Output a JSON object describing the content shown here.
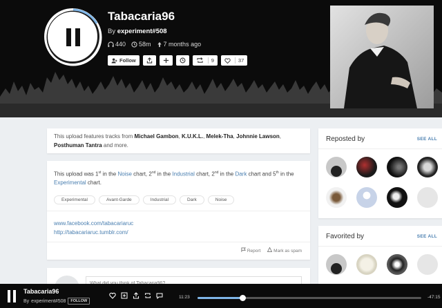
{
  "colors": {
    "accent": "#4a7fb0",
    "progress": "#7fb6e8",
    "dark": "#0b0b0b"
  },
  "track": {
    "title": "Tabacaria96",
    "by_prefix": "By",
    "author": "experiment#508",
    "plays": "440",
    "duration": "58m",
    "age": "7 months ago"
  },
  "actions": {
    "follow_label": "Follow",
    "repost_count": "9",
    "favorite_count": "37"
  },
  "description": {
    "intro": "This upload features tracks from",
    "artists": [
      "Michael Gambon",
      "K.U.K.L.",
      "Melek-Tha",
      "Johnnie Lawson",
      "Posthuman Tantra"
    ],
    "outro": "and more."
  },
  "ranking": {
    "prefix": "This upload was",
    "items": [
      {
        "pos": "1",
        "suffix": "st",
        "pre": "in the",
        "chart": "Noise",
        "post": "chart,"
      },
      {
        "pos": "2",
        "suffix": "nd",
        "pre": "in the",
        "chart": "Industrial",
        "post": "chart,"
      },
      {
        "pos": "2",
        "suffix": "nd",
        "pre": "in the",
        "chart": "Dark",
        "post": "chart and"
      },
      {
        "pos": "5",
        "suffix": "th",
        "pre": "in the",
        "chart": "Experimental",
        "post": "chart."
      }
    ]
  },
  "tags": [
    "Experimental",
    "Avant-Garde",
    "Industrial",
    "Dark",
    "Noise"
  ],
  "links": [
    "www.facebook.com/tabacariaruc",
    "http://tabacariaruc.tumblr.com/"
  ],
  "footer": {
    "report": "Report",
    "spam": "Mark as spam"
  },
  "comment": {
    "placeholder": "What did you think of Tabacaria96?"
  },
  "sidebar": {
    "reposted_title": "Reposted by",
    "favorited_title": "Favorited by",
    "see_all": "SEE ALL"
  },
  "player": {
    "title": "Tabacaria96",
    "author": "experiment#508",
    "follow": "FOLLOW",
    "elapsed": "11:23",
    "remaining": "-47:15",
    "progress": 0.2
  }
}
